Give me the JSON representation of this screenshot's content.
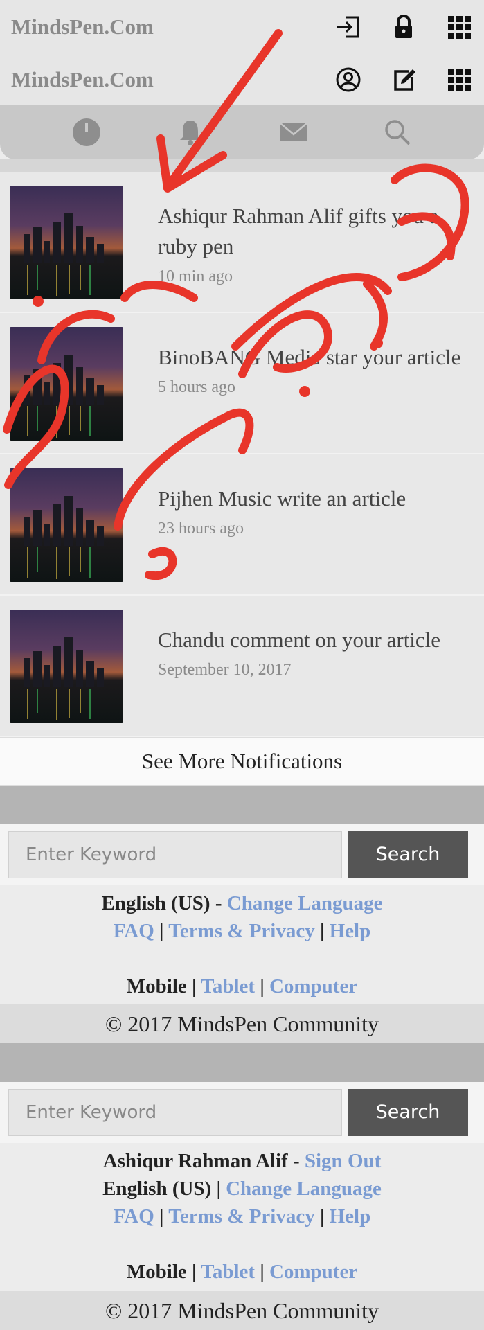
{
  "header1": {
    "brand": "MindsPen.Com",
    "icons": [
      "login-icon",
      "lock-icon",
      "grid-icon"
    ]
  },
  "header2": {
    "brand": "MindsPen.Com",
    "icons": [
      "user-circle-icon",
      "compose-icon",
      "grid-icon"
    ]
  },
  "tabbar": {
    "icons": [
      "dashboard-icon",
      "bell-icon",
      "mail-icon",
      "search-icon"
    ]
  },
  "notifications": [
    {
      "text": "Ashiqur Rahman Alif gifts you a ruby pen",
      "time": "10 min ago"
    },
    {
      "text": "BinoBANG Media star your article",
      "time": "5 hours ago"
    },
    {
      "text": "Pijhen Music write an article",
      "time": "23 hours ago"
    },
    {
      "text": "Chandu comment on your article",
      "time": "September 10, 2017"
    }
  ],
  "see_more": "See More Notifications",
  "footer1": {
    "search_placeholder": "Enter Keyword",
    "search_button": "Search",
    "language": "English (US)",
    "sep1": " - ",
    "change_language": "Change Language",
    "faq": "FAQ",
    "terms": "Terms & Privacy",
    "help": "Help",
    "mobile": "Mobile",
    "tablet": "Tablet",
    "computer": "Computer",
    "copyright": "© 2017 MindsPen Community"
  },
  "footer2": {
    "search_placeholder": "Enter Keyword",
    "search_button": "Search",
    "user": "Ashiqur Rahman Alif",
    "sign_out": "Sign Out",
    "language": "English (US)",
    "change_language": "Change Language",
    "faq": "FAQ",
    "terms": "Terms & Privacy",
    "help": "Help",
    "mobile": "Mobile",
    "tablet": "Tablet",
    "computer": "Computer",
    "copyright": "© 2017 MindsPen Community"
  },
  "annotation_color": "#e8352a"
}
